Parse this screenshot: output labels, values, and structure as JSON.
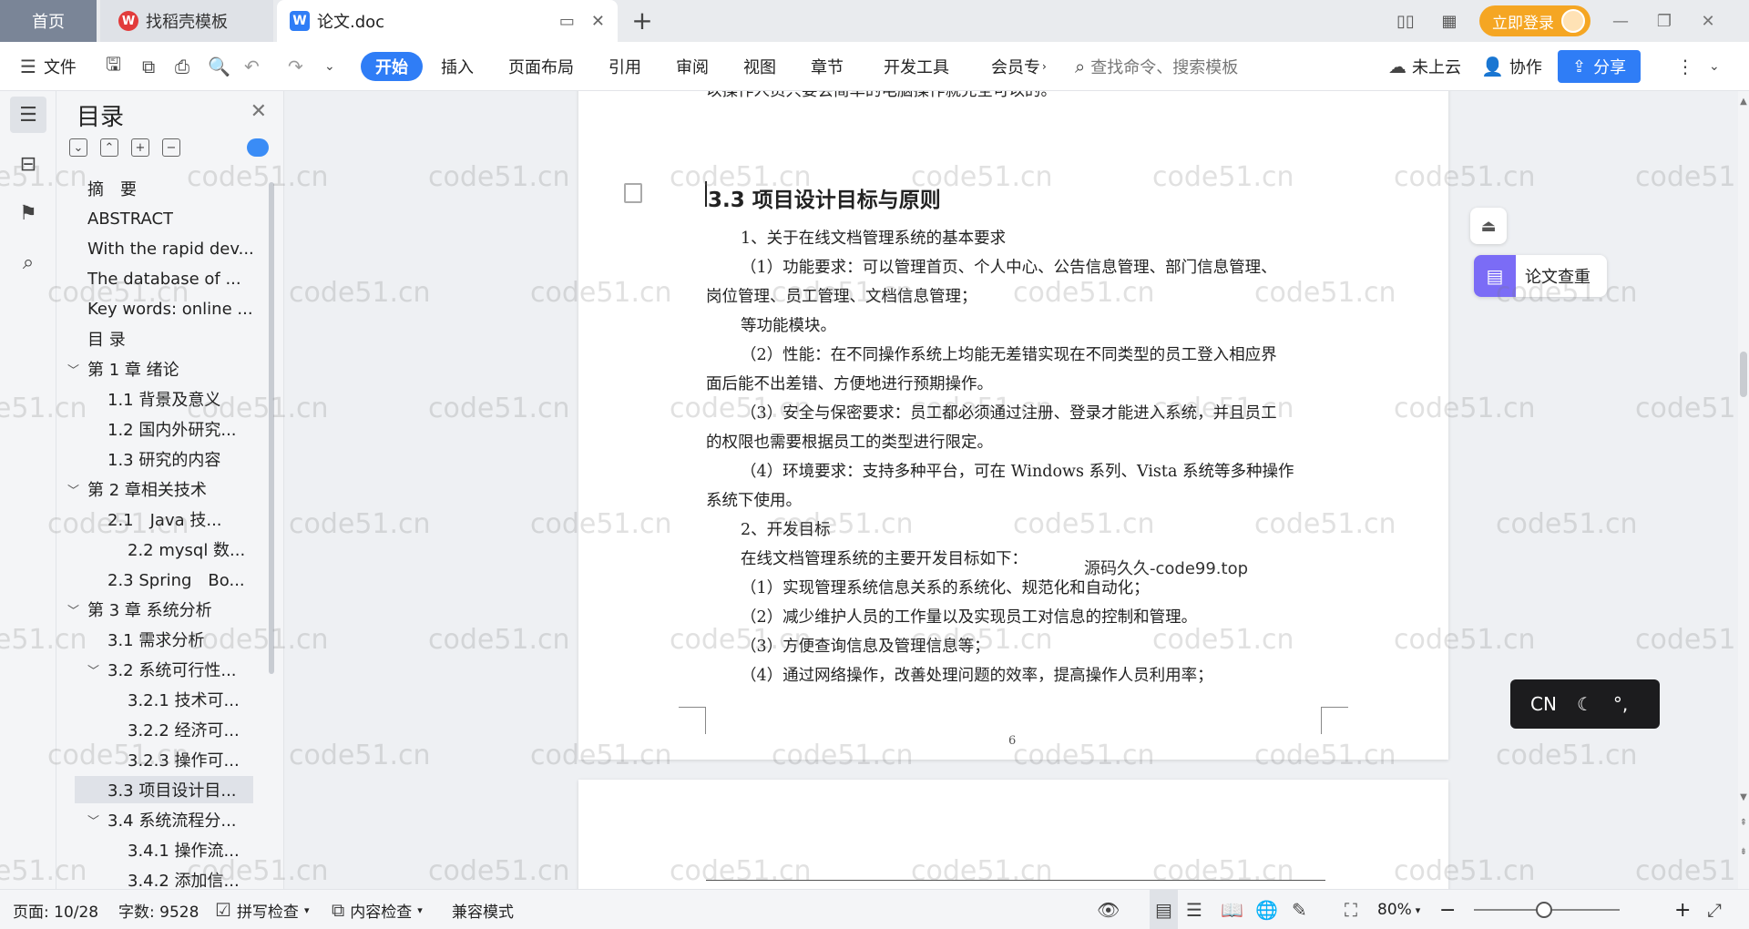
{
  "tabs": {
    "home": "首页",
    "template": "找稻壳模板",
    "doc": "论文.doc",
    "login": "立即登录"
  },
  "ribbon": {
    "file": "文件",
    "menus": [
      "开始",
      "插入",
      "页面布局",
      "引用",
      "审阅",
      "视图",
      "章节",
      "开发工具",
      "会员专"
    ],
    "search_placeholder": "查找命令、搜索模板",
    "cloud": "未上云",
    "collab": "协作",
    "share": "分享"
  },
  "toc": {
    "title": "目录",
    "items": [
      {
        "label": "摘　要",
        "level": 1,
        "chev": ""
      },
      {
        "label": "ABSTRACT",
        "level": 1,
        "chev": ""
      },
      {
        "label": "With the rapid dev...",
        "level": 1,
        "chev": ""
      },
      {
        "label": "The database of ...",
        "level": 1,
        "chev": ""
      },
      {
        "label": "Key words: online ...",
        "level": 1,
        "chev": ""
      },
      {
        "label": "目 录",
        "level": 1,
        "chev": ""
      },
      {
        "label": "第 1 章 绪论",
        "level": 1,
        "chev": "v"
      },
      {
        "label": "1.1 背景及意义",
        "level": 2,
        "chev": ""
      },
      {
        "label": "1.2 国内外研究...",
        "level": 2,
        "chev": ""
      },
      {
        "label": "1.3 研究的内容",
        "level": 2,
        "chev": ""
      },
      {
        "label": "第 2 章相关技术",
        "level": 1,
        "chev": "v"
      },
      {
        "label": "2.1　Java 技...",
        "level": 2,
        "chev": ""
      },
      {
        "label": "2.2 mysql 数...",
        "level": 3,
        "chev": ""
      },
      {
        "label": "2.3 Spring　Bo...",
        "level": 2,
        "chev": ""
      },
      {
        "label": "第 3 章 系统分析",
        "level": 1,
        "chev": "v"
      },
      {
        "label": "3.1 需求分析",
        "level": 2,
        "chev": ""
      },
      {
        "label": "3.2 系统可行性...",
        "level": 2,
        "chev": "v"
      },
      {
        "label": "3.2.1 技术可...",
        "level": 3,
        "chev": ""
      },
      {
        "label": "3.2.2 经济可...",
        "level": 3,
        "chev": ""
      },
      {
        "label": "3.2.3 操作可...",
        "level": 3,
        "chev": ""
      },
      {
        "label": "3.3 项目设计目...",
        "level": 2,
        "chev": "",
        "active": true
      },
      {
        "label": "3.4 系统流程分...",
        "level": 2,
        "chev": "v"
      },
      {
        "label": "3.4.1 操作流...",
        "level": 3,
        "chev": ""
      },
      {
        "label": "3.4.2 添加信...",
        "level": 3,
        "chev": ""
      }
    ]
  },
  "doc": {
    "top_cut": "以操作人员只要会简单的电脑操作就完全可以的。",
    "heading": "3.3  项目设计目标与原则",
    "lines": [
      "1、关于在线文档管理系统的基本要求",
      "（1）功能要求：可以管理首页、个人中心、公告信息管理、部门信息管理、",
      "岗位管理、员工管理、文档信息管理；",
      "等功能模块。",
      "（2）性能：在不同操作系统上均能无差错实现在不同类型的员工登入相应界",
      "面后能不出差错、方便地进行预期操作。",
      "（3）安全与保密要求：员工都必须通过注册、登录才能进入系统，并且员工",
      "的权限也需要根据员工的类型进行限定。",
      "（4）环境要求：支持多种平台，可在 Windows 系列、Vista 系统等多种操作",
      "系统下使用。",
      "2、开发目标",
      "在线文档管理系统的主要开发目标如下：",
      "（1）实现管理系统信息关系的系统化、规范化和自动化；",
      "（2）减少维护人员的工作量以及实现员工对信息的控制和管理。",
      "（3）方便查询信息及管理信息等；",
      "（4）通过网络操作，改善处理问题的效率，提高操作人员利用率；"
    ],
    "page_number": "6",
    "overlay_text": "源码久久-code99.top",
    "watermark": "code51.cn"
  },
  "side": {
    "check_label": "论文查重",
    "ime": "CN"
  },
  "status": {
    "page": "页面: 10/28",
    "words": "字数: 9528",
    "spell": "拼写检查",
    "content": "内容检查",
    "compat": "兼容模式",
    "zoom": "80%"
  }
}
